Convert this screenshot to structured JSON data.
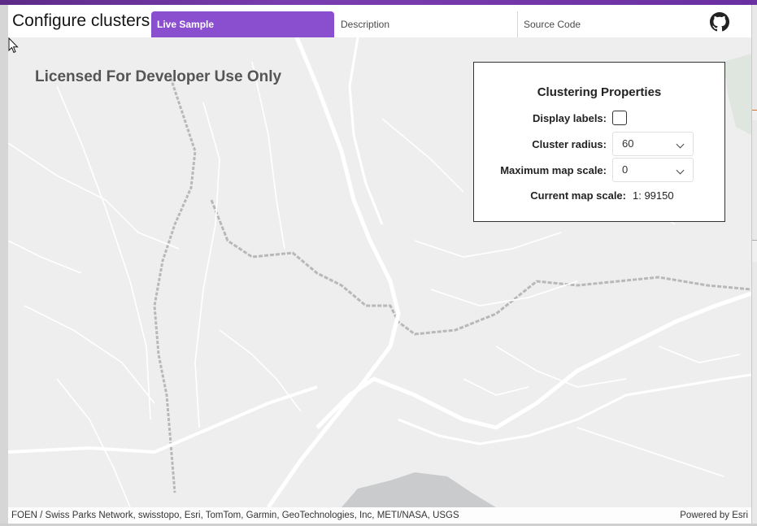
{
  "header": {
    "title": "Configure clusters",
    "tabs": [
      {
        "label": "Live Sample",
        "active": true
      },
      {
        "label": "Description",
        "active": false
      },
      {
        "label": "Source Code",
        "active": false
      }
    ],
    "github_icon": "github-icon"
  },
  "map": {
    "watermark": "Licensed For Developer Use Only",
    "attribution": "FOEN / Swiss Parks Network, swisstopo, Esri, TomTom, Garmin, GeoTechnologies, Inc, METI/NASA, USGS",
    "powered_by": "Powered by Esri"
  },
  "panel": {
    "title": "Clustering Properties",
    "display_labels_label": "Display labels:",
    "display_labels_checked": false,
    "cluster_radius_label": "Cluster radius:",
    "cluster_radius_value": "60",
    "max_scale_label": "Maximum map scale:",
    "max_scale_value": "0",
    "current_scale_label": "Current map scale:",
    "current_scale_value": "1: 99150"
  },
  "colors": {
    "accent": "#8a4fcf",
    "topbar": "#6a2fa0",
    "map_bg": "#eeeeee",
    "road": "#ffffff",
    "boundary": "#bdbdbd"
  }
}
